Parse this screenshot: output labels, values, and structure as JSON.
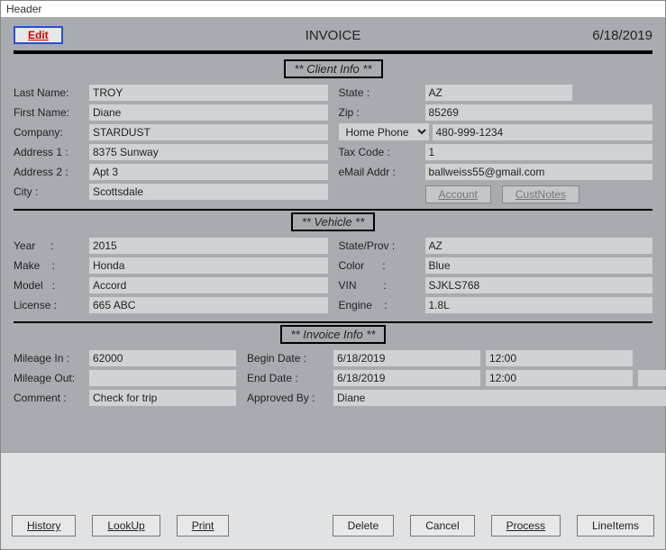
{
  "window_title": "Header",
  "top": {
    "edit_label": "Edit",
    "title": "INVOICE",
    "date": "6/18/2019"
  },
  "sections": {
    "client": "** Client Info **",
    "vehicle": "**  Vehicle  **",
    "invoice": "** Invoice Info **"
  },
  "client": {
    "labels": {
      "last_name": "Last Name:",
      "first_name": "First Name:",
      "company": "Company:",
      "address1": "Address 1 :",
      "address2": "Address 2 :",
      "city": "City :",
      "state": "State :",
      "zip": "Zip :",
      "tax_code": "Tax Code :",
      "email": "eMail Addr :"
    },
    "last_name": "TROY",
    "first_name": "Diane",
    "company": "STARDUST",
    "address1": "8375 Sunway",
    "address2": "Apt 3",
    "city": "Scottsdale",
    "state": "AZ",
    "zip": "85269",
    "phone_type": "Home Phone",
    "phone": "480-999-1234",
    "tax_code": "1",
    "email": "ballweiss55@gmail.com",
    "buttons": {
      "account": "Account",
      "custnotes": "CustNotes"
    }
  },
  "vehicle": {
    "labels": {
      "year": "Year",
      "make": "Make",
      "model": "Model",
      "license": "License",
      "state": "State/Prov :",
      "color": "Color",
      "vin": "VIN",
      "engine": "Engine"
    },
    "year": "2015",
    "make": "Honda",
    "model": "Accord",
    "license": "665 ABC",
    "state": "AZ",
    "color": "Blue",
    "vin": "SJKLS768",
    "engine": "1.8L"
  },
  "invoice": {
    "labels": {
      "mileage_in": "Mileage In :",
      "mileage_out": "Mileage Out:",
      "comment": "Comment :",
      "begin": "Begin Date :",
      "end": "End Date :",
      "approved": "Approved By :"
    },
    "mileage_in": "62000",
    "mileage_out": "",
    "comment": "Check for trip",
    "begin_date": "6/18/2019",
    "begin_time": "12:00",
    "end_date": "6/18/2019",
    "end_time": "12:00",
    "approved_by": "Diane"
  },
  "footer": {
    "history": "History",
    "lookup": "LookUp",
    "print": "Print",
    "delete": "Delete",
    "cancel": "Cancel",
    "process": "Process",
    "lineitems": "LineItems"
  }
}
